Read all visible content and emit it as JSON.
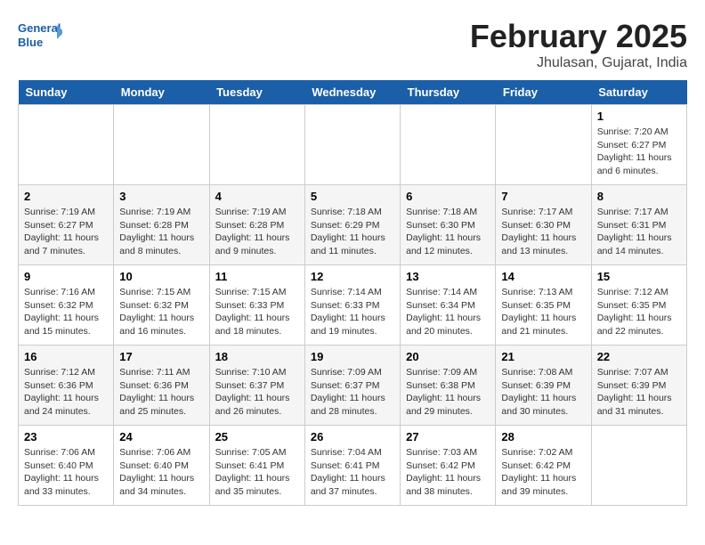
{
  "header": {
    "logo_line1": "General",
    "logo_line2": "Blue",
    "title": "February 2025",
    "subtitle": "Jhulasan, Gujarat, India"
  },
  "weekdays": [
    "Sunday",
    "Monday",
    "Tuesday",
    "Wednesday",
    "Thursday",
    "Friday",
    "Saturday"
  ],
  "weeks": [
    [
      {
        "day": "",
        "info": ""
      },
      {
        "day": "",
        "info": ""
      },
      {
        "day": "",
        "info": ""
      },
      {
        "day": "",
        "info": ""
      },
      {
        "day": "",
        "info": ""
      },
      {
        "day": "",
        "info": ""
      },
      {
        "day": "1",
        "info": "Sunrise: 7:20 AM\nSunset: 6:27 PM\nDaylight: 11 hours and 6 minutes."
      }
    ],
    [
      {
        "day": "2",
        "info": "Sunrise: 7:19 AM\nSunset: 6:27 PM\nDaylight: 11 hours and 7 minutes."
      },
      {
        "day": "3",
        "info": "Sunrise: 7:19 AM\nSunset: 6:28 PM\nDaylight: 11 hours and 8 minutes."
      },
      {
        "day": "4",
        "info": "Sunrise: 7:19 AM\nSunset: 6:28 PM\nDaylight: 11 hours and 9 minutes."
      },
      {
        "day": "5",
        "info": "Sunrise: 7:18 AM\nSunset: 6:29 PM\nDaylight: 11 hours and 11 minutes."
      },
      {
        "day": "6",
        "info": "Sunrise: 7:18 AM\nSunset: 6:30 PM\nDaylight: 11 hours and 12 minutes."
      },
      {
        "day": "7",
        "info": "Sunrise: 7:17 AM\nSunset: 6:30 PM\nDaylight: 11 hours and 13 minutes."
      },
      {
        "day": "8",
        "info": "Sunrise: 7:17 AM\nSunset: 6:31 PM\nDaylight: 11 hours and 14 minutes."
      }
    ],
    [
      {
        "day": "9",
        "info": "Sunrise: 7:16 AM\nSunset: 6:32 PM\nDaylight: 11 hours and 15 minutes."
      },
      {
        "day": "10",
        "info": "Sunrise: 7:15 AM\nSunset: 6:32 PM\nDaylight: 11 hours and 16 minutes."
      },
      {
        "day": "11",
        "info": "Sunrise: 7:15 AM\nSunset: 6:33 PM\nDaylight: 11 hours and 18 minutes."
      },
      {
        "day": "12",
        "info": "Sunrise: 7:14 AM\nSunset: 6:33 PM\nDaylight: 11 hours and 19 minutes."
      },
      {
        "day": "13",
        "info": "Sunrise: 7:14 AM\nSunset: 6:34 PM\nDaylight: 11 hours and 20 minutes."
      },
      {
        "day": "14",
        "info": "Sunrise: 7:13 AM\nSunset: 6:35 PM\nDaylight: 11 hours and 21 minutes."
      },
      {
        "day": "15",
        "info": "Sunrise: 7:12 AM\nSunset: 6:35 PM\nDaylight: 11 hours and 22 minutes."
      }
    ],
    [
      {
        "day": "16",
        "info": "Sunrise: 7:12 AM\nSunset: 6:36 PM\nDaylight: 11 hours and 24 minutes."
      },
      {
        "day": "17",
        "info": "Sunrise: 7:11 AM\nSunset: 6:36 PM\nDaylight: 11 hours and 25 minutes."
      },
      {
        "day": "18",
        "info": "Sunrise: 7:10 AM\nSunset: 6:37 PM\nDaylight: 11 hours and 26 minutes."
      },
      {
        "day": "19",
        "info": "Sunrise: 7:09 AM\nSunset: 6:37 PM\nDaylight: 11 hours and 28 minutes."
      },
      {
        "day": "20",
        "info": "Sunrise: 7:09 AM\nSunset: 6:38 PM\nDaylight: 11 hours and 29 minutes."
      },
      {
        "day": "21",
        "info": "Sunrise: 7:08 AM\nSunset: 6:39 PM\nDaylight: 11 hours and 30 minutes."
      },
      {
        "day": "22",
        "info": "Sunrise: 7:07 AM\nSunset: 6:39 PM\nDaylight: 11 hours and 31 minutes."
      }
    ],
    [
      {
        "day": "23",
        "info": "Sunrise: 7:06 AM\nSunset: 6:40 PM\nDaylight: 11 hours and 33 minutes."
      },
      {
        "day": "24",
        "info": "Sunrise: 7:06 AM\nSunset: 6:40 PM\nDaylight: 11 hours and 34 minutes."
      },
      {
        "day": "25",
        "info": "Sunrise: 7:05 AM\nSunset: 6:41 PM\nDaylight: 11 hours and 35 minutes."
      },
      {
        "day": "26",
        "info": "Sunrise: 7:04 AM\nSunset: 6:41 PM\nDaylight: 11 hours and 37 minutes."
      },
      {
        "day": "27",
        "info": "Sunrise: 7:03 AM\nSunset: 6:42 PM\nDaylight: 11 hours and 38 minutes."
      },
      {
        "day": "28",
        "info": "Sunrise: 7:02 AM\nSunset: 6:42 PM\nDaylight: 11 hours and 39 minutes."
      },
      {
        "day": "",
        "info": ""
      }
    ]
  ]
}
